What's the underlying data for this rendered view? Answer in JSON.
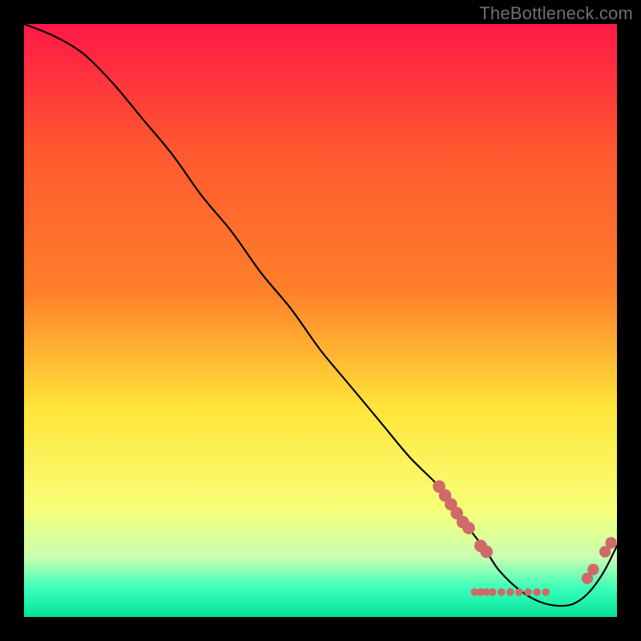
{
  "watermark": "TheBottleneck.com",
  "colors": {
    "background": "#000000",
    "curve": "#000000",
    "marker_fill": "#cf6a68",
    "marker_stroke": "#cf6a68",
    "watermark": "#6f6f6f",
    "gradient_top": "#ff1846",
    "gradient_mid_top": "#ff7f2a",
    "gradient_mid": "#ffe63a",
    "gradient_mid_bottom": "#f7ff7a",
    "gradient_bottom1": "#c7ffb0",
    "gradient_bottom2": "#3fffb9",
    "gradient_bottom3": "#00e49a"
  },
  "chart_data": {
    "type": "line",
    "title": "",
    "xlabel": "",
    "ylabel": "",
    "xlim": [
      0,
      100
    ],
    "ylim": [
      0,
      100
    ],
    "grid": false,
    "legend": null,
    "series": [
      {
        "name": "curve",
        "x": [
          0,
          5,
          10,
          15,
          20,
          25,
          30,
          35,
          40,
          45,
          50,
          55,
          60,
          65,
          70,
          72,
          75,
          78,
          80,
          83,
          86,
          89,
          92,
          94,
          96,
          98,
          100
        ],
        "y": [
          100,
          98,
          95,
          90,
          84,
          78,
          71,
          65,
          58,
          52,
          45,
          39,
          33,
          27,
          22,
          19,
          15,
          11,
          8,
          5,
          3,
          2,
          2,
          3,
          5,
          8,
          12
        ]
      }
    ],
    "markers": [
      {
        "x": 70,
        "y": 22,
        "r": 1.3
      },
      {
        "x": 71,
        "y": 20.5,
        "r": 1.3
      },
      {
        "x": 72,
        "y": 19,
        "r": 1.3
      },
      {
        "x": 73,
        "y": 17.5,
        "r": 1.3
      },
      {
        "x": 74,
        "y": 16,
        "r": 1.3
      },
      {
        "x": 75,
        "y": 15,
        "r": 1.3
      },
      {
        "x": 77,
        "y": 12,
        "r": 1.3
      },
      {
        "x": 78,
        "y": 11,
        "r": 1.3
      },
      {
        "x": 76,
        "y": 4.2,
        "r": 0.8
      },
      {
        "x": 77,
        "y": 4.2,
        "r": 0.8
      },
      {
        "x": 78,
        "y": 4.2,
        "r": 0.8
      },
      {
        "x": 79,
        "y": 4.2,
        "r": 0.8
      },
      {
        "x": 80.5,
        "y": 4.2,
        "r": 0.8
      },
      {
        "x": 82,
        "y": 4.2,
        "r": 0.8
      },
      {
        "x": 83.5,
        "y": 4.2,
        "r": 0.8
      },
      {
        "x": 85,
        "y": 4.2,
        "r": 0.8
      },
      {
        "x": 86.5,
        "y": 4.2,
        "r": 0.8
      },
      {
        "x": 88,
        "y": 4.2,
        "r": 0.8
      },
      {
        "x": 95,
        "y": 6.5,
        "r": 1.2
      },
      {
        "x": 96,
        "y": 8,
        "r": 1.2
      },
      {
        "x": 98,
        "y": 11,
        "r": 1.2
      },
      {
        "x": 99,
        "y": 12.5,
        "r": 1.2
      }
    ]
  }
}
